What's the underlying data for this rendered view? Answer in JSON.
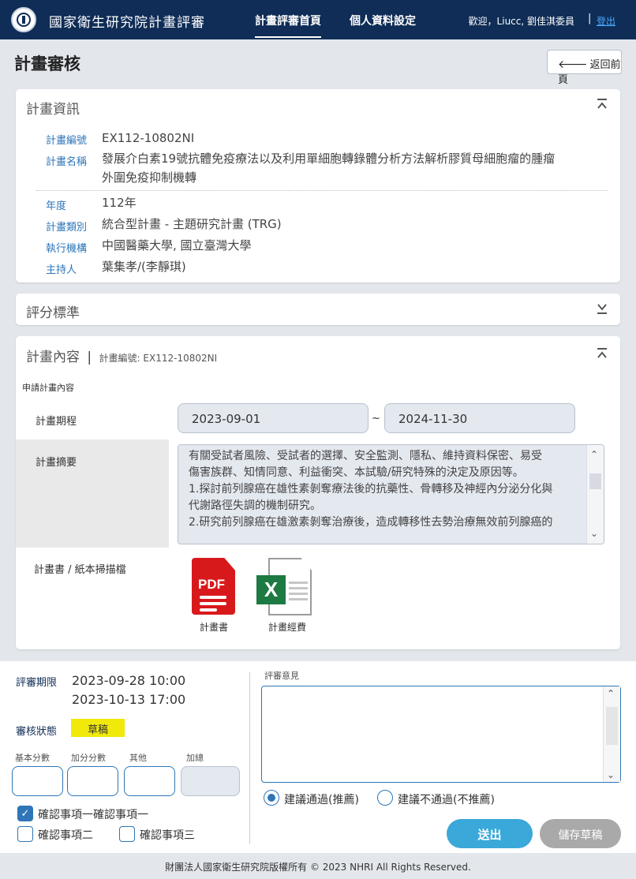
{
  "header": {
    "app_title": "國家衛生研究院計畫評審",
    "nav": [
      "計畫評審首頁",
      "個人資料設定"
    ],
    "welcome": "歡迎，Liucc, 劉佳淇委員",
    "separator": "|",
    "logout": "登出"
  },
  "page": {
    "title": "計畫審核",
    "back_label": "返回前頁"
  },
  "project_info": {
    "title": "計畫資訊",
    "fields": [
      {
        "label": "計畫編號",
        "value": "EX112-10802NI"
      },
      {
        "label": "計畫名稱",
        "value_line1": "發展介白素19號抗體免疫療法以及利用單細胞轉錄體分析方法解析膠質母細胞瘤的腫瘤",
        "value_line2": "外圍免疫抑制機轉"
      },
      {
        "label": "年度",
        "value": "112年"
      },
      {
        "label": "計畫類別",
        "value": "統合型計畫 - 主題研究計畫 (TRG)"
      },
      {
        "label": "執行機構",
        "value": "中國醫藥大學, 國立臺灣大學"
      },
      {
        "label": "主持人",
        "value": "葉集孝/(李靜琪)"
      }
    ]
  },
  "scoring": {
    "title": "評分標準"
  },
  "content": {
    "title": "計畫內容",
    "divider": "|",
    "subtitle": "計畫編號: EX112-10802NI",
    "section_label": "申請計畫內容",
    "period_label": "計畫期程",
    "start_date": "2023-09-01",
    "tilde": "~",
    "end_date": "2024-11-30",
    "summary_label": "計畫摘要",
    "summary_lines": [
      "有關受試者風險、受試者的選擇、安全監測、隱私、維持資料保密、易受",
      "傷害族群、知情同意、利益衝突、本試驗/研究特殊的決定及原因等。",
      "1.探討前列腺癌在雄性素剝奪療法後的抗藥性、骨轉移及神經內分泌分化與",
      "代謝路徑失調的機制研究。",
      "2.研究前列腺癌在雄激素剝奪治療後，造成轉移性去勢治療無效前列腺癌的"
    ],
    "files_label": "計畫書 / 紙本掃描檔",
    "files": [
      {
        "name": "計畫書",
        "icon": "pdf-file-icon",
        "badge": "PDF"
      },
      {
        "name": "計畫經費",
        "icon": "excel-file-icon",
        "badge": "X"
      }
    ]
  },
  "review": {
    "deadline_label": "評審期限",
    "deadline_start": "2023-09-28 10:00",
    "deadline_end": "2023-10-13 17:00",
    "status_label": "審核狀態",
    "status": "草稿",
    "score_labels": [
      "基本分數",
      "加分分數",
      "其他",
      "加總"
    ],
    "checks": [
      {
        "label": "確認事項一確認事項一",
        "checked": true
      },
      {
        "label": "確認事項二",
        "checked": false
      },
      {
        "label": "確認事項三",
        "checked": false
      }
    ],
    "checkmark": "✓",
    "comment_label": "評審意見",
    "radios": [
      {
        "label": "建議通過(推薦)",
        "selected": true
      },
      {
        "label": "建議不通過(不推薦)",
        "selected": false
      }
    ],
    "submit_label": "送出",
    "save_draft_label": "儲存草稿"
  },
  "footer": {
    "text": "財團法人國家衛生研究院版權所有 © 2023 NHRI All Rights Reserved."
  },
  "colors": {
    "navbar": "#0f2d56",
    "accent": "#2e76b8",
    "submit": "#3aa8d8",
    "draft_badge": "#f1e90a"
  },
  "icons": {
    "back": "arrow-left-icon",
    "collapse": "chevron-up-double-icon",
    "expand": "chevron-down-double-icon"
  }
}
